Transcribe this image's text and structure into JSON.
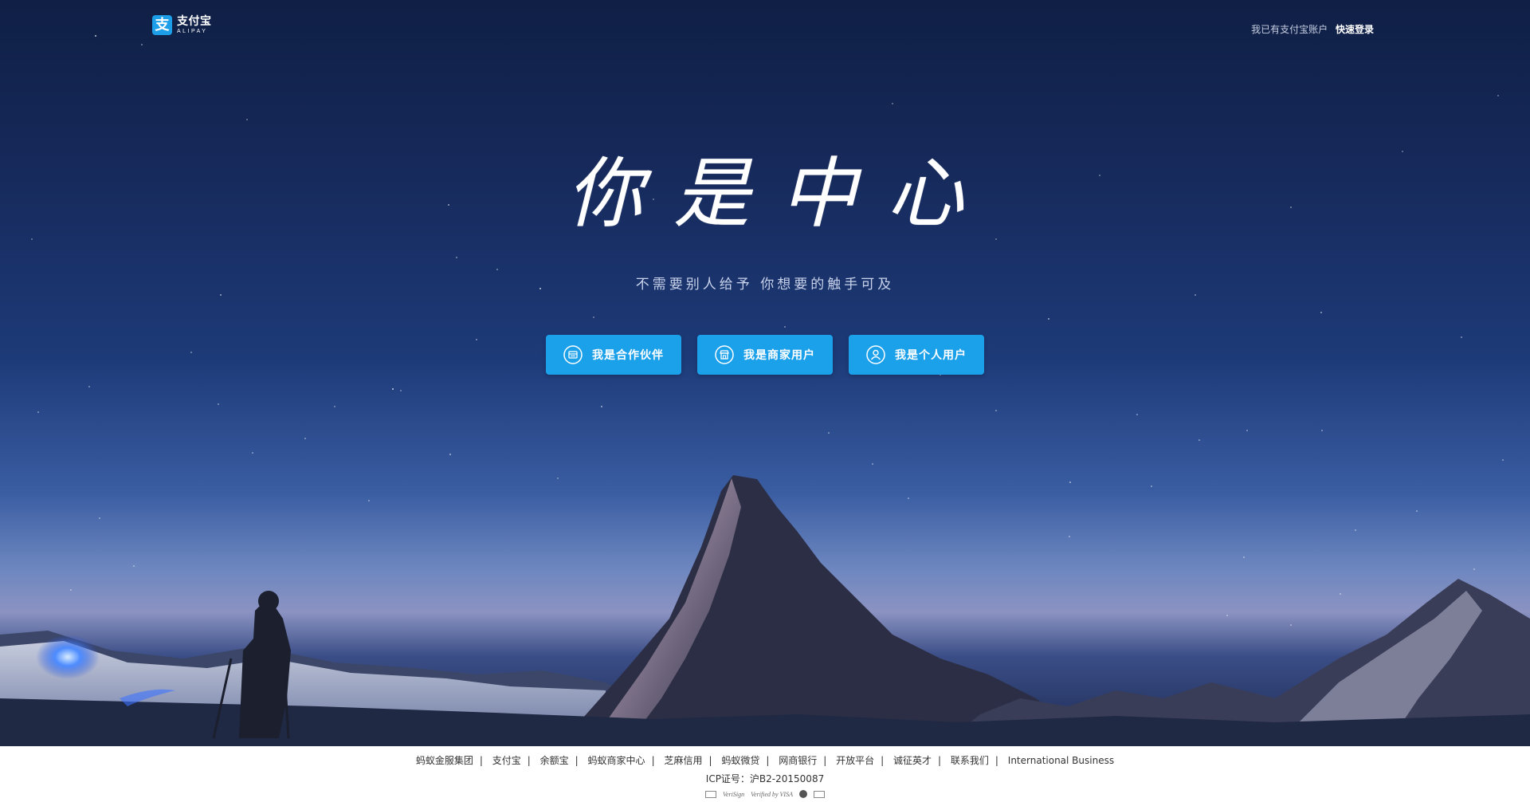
{
  "header": {
    "logo_cn": "支付宝",
    "logo_en": "ALIPAY",
    "logo_mark": "支",
    "account_prompt": "我已有支付宝账户",
    "login_label": "快速登录"
  },
  "hero": {
    "slogan": "你是中心",
    "subtitle": "不需要别人给予  你想要的触手可及"
  },
  "roles": [
    {
      "label": "我是合作伙伴",
      "icon": "partner-icon"
    },
    {
      "label": "我是商家用户",
      "icon": "shop-icon"
    },
    {
      "label": "我是个人用户",
      "icon": "user-icon"
    }
  ],
  "footer": {
    "links": [
      "蚂蚁金服集团",
      "支付宝",
      "余额宝",
      "蚂蚁商家中心",
      "芝麻信用",
      "蚂蚁微贷",
      "网商银行",
      "开放平台",
      "诚征英才",
      "联系我们",
      "International Business"
    ],
    "icp": "ICP证号：沪B2-20150087",
    "badges": [
      "VeriSign",
      "Verified by VISA"
    ]
  },
  "colors": {
    "button": "#1ba0ea",
    "brand": "#1d9ee8",
    "sky_top": "#0f1f45"
  }
}
